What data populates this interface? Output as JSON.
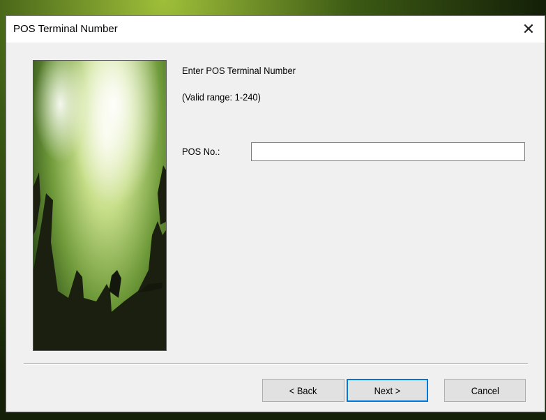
{
  "dialog": {
    "title": "POS Terminal Number",
    "close_glyph": "✕",
    "heading": "Enter POS Terminal Number",
    "range_text": "(Valid range: 1-240)",
    "pos_label": "POS No.:",
    "pos_value": ""
  },
  "buttons": {
    "back": "< Back",
    "next": "Next >",
    "cancel": "Cancel"
  },
  "colors": {
    "focus_border": "#0078d7",
    "dialog_bg": "#f0f0f0"
  },
  "icons": {
    "close": "close-icon"
  }
}
